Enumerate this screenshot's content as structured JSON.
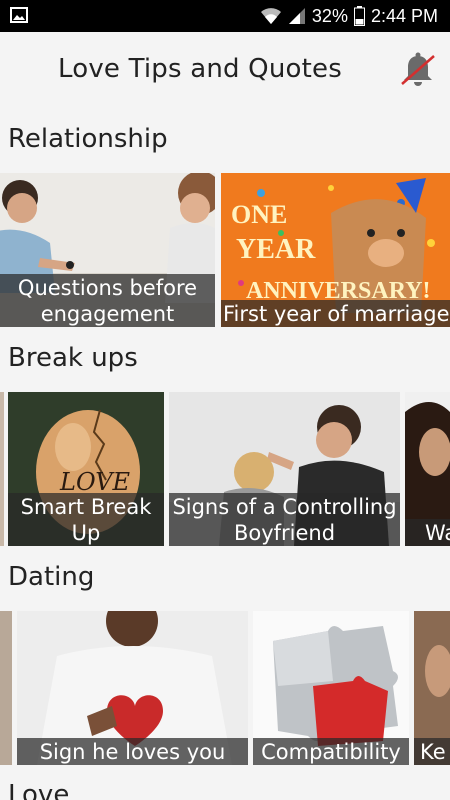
{
  "status_bar": {
    "battery_percent": "32%",
    "time": "2:44 PM",
    "icons": [
      "image-icon",
      "wifi-icon",
      "signal-icon",
      "battery-icon"
    ]
  },
  "app_bar": {
    "title": "Love Tips and Quotes",
    "notification_icon": "bell-off-icon"
  },
  "sections": [
    {
      "title": "Relationship",
      "cards": [
        {
          "label": "Questions before engagement",
          "image": "proposal-photo"
        },
        {
          "label": "First year of marriage",
          "image": "one-year-anniversary-illustration"
        }
      ]
    },
    {
      "title": "Break ups",
      "cards": [
        {
          "label": "",
          "image": "partial-photo"
        },
        {
          "label": "Smart Break Up",
          "image": "cracked-egg-love-photo"
        },
        {
          "label": "Signs of a Controlling Boyfriend",
          "image": "arguing-couple-photo"
        },
        {
          "label": "Wa",
          "image": "woman-portrait-photo"
        }
      ]
    },
    {
      "title": "Dating",
      "cards": [
        {
          "label": "",
          "image": "partial-photo"
        },
        {
          "label": "Sign he loves you",
          "image": "man-holding-heart-photo"
        },
        {
          "label": "Compatibility",
          "image": "puzzle-pieces-photo"
        },
        {
          "label": "Ke",
          "image": "partial-photo"
        }
      ]
    },
    {
      "title": "Love",
      "cards": []
    }
  ],
  "colors": {
    "background": "#f4f4f4",
    "status_bar": "#000000",
    "caption_overlay": "rgba(40,40,40,0.72)",
    "bell_slash": "#d32f2f"
  }
}
